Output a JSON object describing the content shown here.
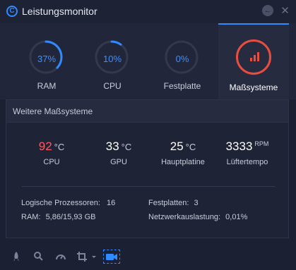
{
  "window": {
    "title": "Leistungsmonitor",
    "back_glyph": "←",
    "close_glyph": "✕"
  },
  "tabs": [
    {
      "label": "RAM",
      "value": "37%",
      "percent": 37
    },
    {
      "label": "CPU",
      "value": "10%",
      "percent": 10
    },
    {
      "label": "Festplatte",
      "value": "0%",
      "percent": 0
    },
    {
      "label": "Maßsysteme",
      "icon": "bar-chart-icon",
      "active": true
    }
  ],
  "panel": {
    "title": "Weitere Maßsysteme",
    "metrics": [
      {
        "value": "92",
        "unit": "°C",
        "label": "CPU"
      },
      {
        "value": "33",
        "unit": "°C",
        "label": "GPU"
      },
      {
        "value": "25",
        "unit": "°C",
        "label": "Hauptplatine"
      },
      {
        "value": "3333",
        "unit": "RPM",
        "label": "Lüftertempo"
      }
    ],
    "info": {
      "processors_label": "Logische Prozessoren:",
      "processors_value": "16",
      "ram_label": "RAM:",
      "ram_value": "5,86/15,93 GB",
      "disks_label": "Festplatten:",
      "disks_value": "3",
      "network_label": "Netzwerkauslastung:",
      "network_value": "0,01%"
    }
  },
  "bottom_icons": [
    "rocket-icon",
    "search-icon",
    "speedometer-icon",
    "crop-icon",
    "camera-icon"
  ],
  "colors": {
    "accent": "#2f8bff",
    "hot": "#ff5a5f",
    "active_tab": "#e84e3f",
    "background": "#1c2033"
  }
}
